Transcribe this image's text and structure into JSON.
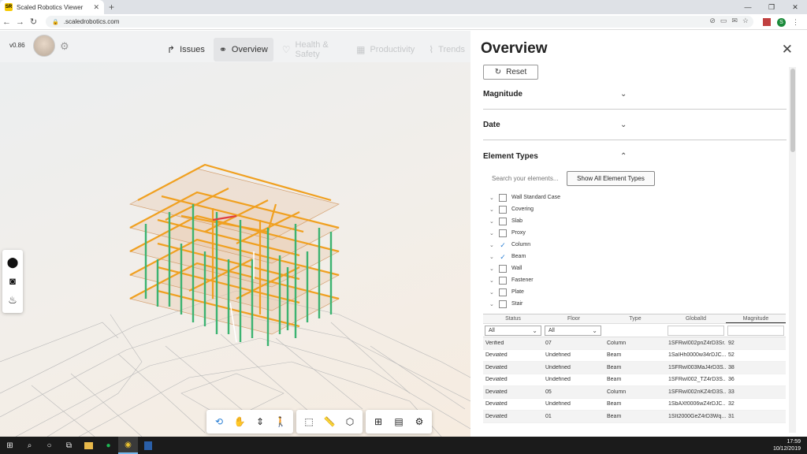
{
  "browser": {
    "tab_title": "Scaled Robotics Viewer",
    "tab_favicon": "SR",
    "new_tab_icon": "+",
    "url": ".scaledrobotics.com",
    "profile_initial": "S"
  },
  "header": {
    "version": "v0.86",
    "tabs": [
      {
        "label": "Issues",
        "icon": "issues-arrow-icon"
      },
      {
        "label": "Overview",
        "icon": "binoculars-icon"
      },
      {
        "label": "Health & Safety",
        "icon": "heart-icon"
      },
      {
        "label": "Productivity",
        "icon": "productivity-icon"
      },
      {
        "label": "Trends",
        "icon": "trends-icon"
      }
    ]
  },
  "panel": {
    "title": "Overview",
    "reset_label": "Reset",
    "sections": [
      {
        "label": "Magnitude",
        "expanded": false
      },
      {
        "label": "Date",
        "expanded": false
      },
      {
        "label": "Element Types",
        "expanded": true
      }
    ],
    "search_placeholder": "Search your elements...",
    "show_all_label": "Show All Element Types",
    "element_types": [
      {
        "label": "Wall Standard Case",
        "checked": false
      },
      {
        "label": "Covering",
        "checked": false
      },
      {
        "label": "Slab",
        "checked": false
      },
      {
        "label": "Proxy",
        "checked": false
      },
      {
        "label": "Column",
        "checked": true
      },
      {
        "label": "Beam",
        "checked": true
      },
      {
        "label": "Wall",
        "checked": false
      },
      {
        "label": "Fastener",
        "checked": false
      },
      {
        "label": "Plate",
        "checked": false
      },
      {
        "label": "Stair",
        "checked": false
      }
    ],
    "table": {
      "columns": [
        "Status",
        "Floor",
        "Type",
        "GlobalId",
        "Magnitude"
      ],
      "status_filter": "All",
      "floor_filter": "All",
      "rows": [
        [
          "Verified",
          "07",
          "Column",
          "1SFRwI002pnZ4rD3Sr...",
          "92"
        ],
        [
          "Deviated",
          "Undefined",
          "Beam",
          "1SaIHh0000w34rDJC...",
          "52"
        ],
        [
          "Deviated",
          "Undefined",
          "Beam",
          "1SFRwI003MaJ4rD3S...",
          "38"
        ],
        [
          "Deviated",
          "Undefined",
          "Beam",
          "1SFRwI002_TZ4rD3S...",
          "36"
        ],
        [
          "Deviated",
          "05",
          "Column",
          "1SFRwI002nKZ4rD3S...",
          "33"
        ],
        [
          "Deviated",
          "Undefined",
          "Beam",
          "1SbAXf0006wZ4rDJC...",
          "32"
        ],
        [
          "Deviated",
          "01",
          "Beam",
          "1SIt2000GeZ4rD3Wq...",
          "31"
        ]
      ]
    }
  },
  "taskbar": {
    "time": "17:59",
    "date": "10/12/2019"
  },
  "colors": {
    "column_green": "#3cb371",
    "beam_orange": "#f0a020",
    "accent_blue": "#2a7fd4"
  }
}
